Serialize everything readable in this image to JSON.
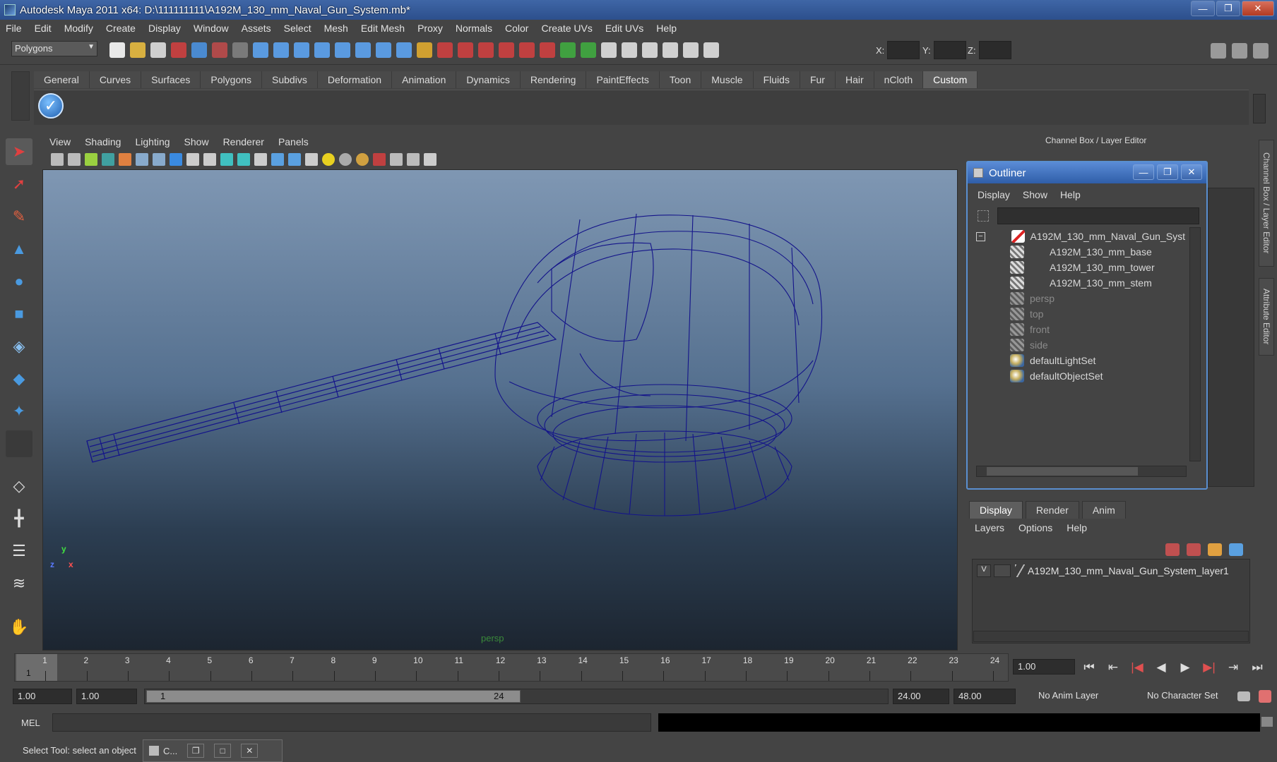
{
  "window": {
    "title": "Autodesk Maya 2011 x64: D:\\111111111\\A192M_130_mm_Naval_Gun_System.mb*",
    "minimize": "—",
    "restore": "❐",
    "close": "✕"
  },
  "menu": [
    "File",
    "Edit",
    "Modify",
    "Create",
    "Display",
    "Window",
    "Assets",
    "Select",
    "Mesh",
    "Edit Mesh",
    "Proxy",
    "Normals",
    "Color",
    "Create UVs",
    "Edit UVs",
    "Help"
  ],
  "statusline": {
    "mode": "Polygons",
    "x_label": "X:",
    "y_label": "Y:",
    "z_label": "Z:"
  },
  "shelf": {
    "tabs": [
      "General",
      "Curves",
      "Surfaces",
      "Polygons",
      "Subdivs",
      "Deformation",
      "Animation",
      "Dynamics",
      "Rendering",
      "PaintEffects",
      "Toon",
      "Muscle",
      "Fluids",
      "Fur",
      "Hair",
      "nCloth",
      "Custom"
    ],
    "active_tab": "Custom",
    "check_glyph": "✓"
  },
  "panel": {
    "menu": [
      "View",
      "Shading",
      "Lighting",
      "Show",
      "Renderer",
      "Panels"
    ],
    "camera_label": "persp",
    "axis": {
      "x": "x",
      "y": "y",
      "z": "z"
    }
  },
  "channel_box": {
    "title": "Channel Box / Layer Editor",
    "side_tabs": [
      "Channel Box / Layer Editor",
      "Attribute Editor"
    ]
  },
  "outliner": {
    "title": "Outliner",
    "menu": [
      "Display",
      "Show",
      "Help"
    ],
    "expand_glyph": "−",
    "items": [
      {
        "label": "A192M_130_mm_Naval_Gun_Syst",
        "type": "group",
        "indent": 0
      },
      {
        "label": "A192M_130_mm_base",
        "type": "mesh",
        "indent": 1
      },
      {
        "label": "A192M_130_mm_tower",
        "type": "mesh",
        "indent": 1
      },
      {
        "label": "A192M_130_mm_stem",
        "type": "mesh",
        "indent": 1
      },
      {
        "label": "persp",
        "type": "camera",
        "indent": 0
      },
      {
        "label": "top",
        "type": "camera",
        "indent": 0
      },
      {
        "label": "front",
        "type": "camera",
        "indent": 0
      },
      {
        "label": "side",
        "type": "camera",
        "indent": 0
      },
      {
        "label": "defaultLightSet",
        "type": "set",
        "indent": 0
      },
      {
        "label": "defaultObjectSet",
        "type": "set",
        "indent": 0
      }
    ]
  },
  "layer_editor": {
    "tabs": [
      "Display",
      "Render",
      "Anim"
    ],
    "active_tab": "Display",
    "menu": [
      "Layers",
      "Options",
      "Help"
    ],
    "layer_visible": "V",
    "layer_name": "A192M_130_mm_Naval_Gun_System_layer1"
  },
  "timeline": {
    "frames": [
      1,
      2,
      3,
      4,
      5,
      6,
      7,
      8,
      9,
      10,
      11,
      12,
      13,
      14,
      15,
      16,
      17,
      18,
      19,
      20,
      21,
      22,
      23,
      24
    ],
    "current_frame": "1",
    "current_time": "1.00",
    "playback_glyphs": [
      "⏮",
      "⇤",
      "|◀",
      "◀",
      "▶",
      "▶|",
      "⇥",
      "⏭"
    ]
  },
  "range": {
    "start": "1.00",
    "playback_start": "1.00",
    "slider_start": "1",
    "slider_end": "24",
    "playback_end": "24.00",
    "end": "48.00",
    "anim_layer": "No Anim Layer",
    "character_set": "No Character Set"
  },
  "commandline": {
    "label": "MEL"
  },
  "helpline": {
    "text": "Select Tool: select an object",
    "mini_window_label": "C..."
  }
}
